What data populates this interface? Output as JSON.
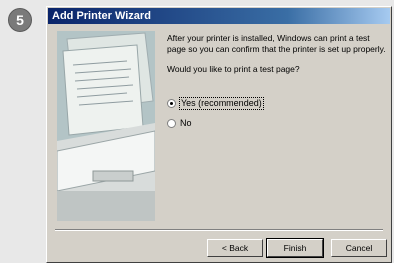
{
  "step": {
    "number": "5"
  },
  "dialog": {
    "title": "Add Printer Wizard",
    "message": "After your printer is installed, Windows can print a test page so you can confirm that the printer is set up properly.",
    "question": "Would you like to print a test page?",
    "options": [
      {
        "label": "Yes (recommended)",
        "selected": true
      },
      {
        "label": "No",
        "selected": false
      }
    ],
    "buttons": {
      "back": "< Back",
      "finish": "Finish",
      "cancel": "Cancel"
    }
  },
  "colors": {
    "titlebar_start": "#0a246a",
    "titlebar_end": "#a6caf0",
    "dialog_face": "#d4d0c8",
    "step_badge": "#7a7a7a"
  }
}
